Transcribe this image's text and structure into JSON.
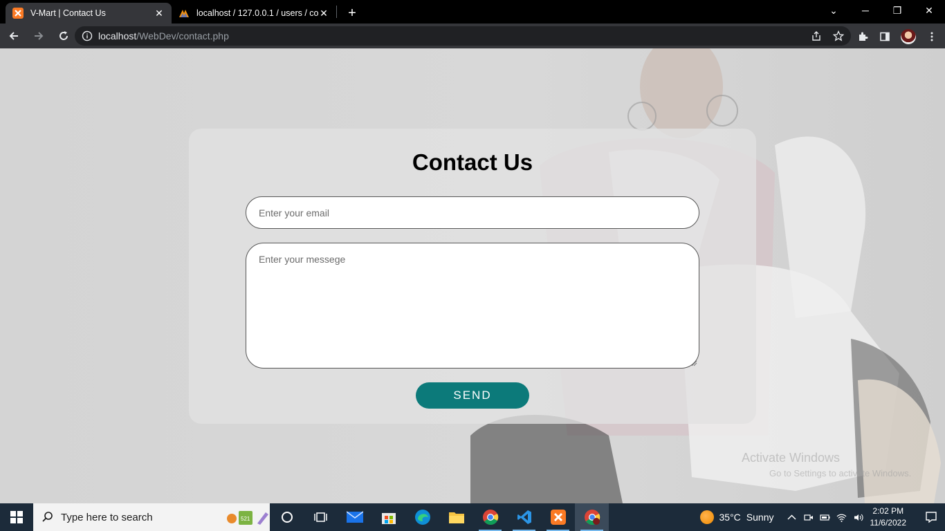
{
  "browser": {
    "tabs": [
      {
        "title": "V-Mart | Contact Us",
        "active": true
      },
      {
        "title": "localhost / 127.0.0.1 / users / con",
        "active": false
      }
    ],
    "url_host": "localhost",
    "url_path": "/WebDev/contact.php"
  },
  "page": {
    "title": "Contact Us",
    "email_placeholder": "Enter your email",
    "message_placeholder": "Enter your messege",
    "send_label": "SEND",
    "watermark_title": "Activate Windows",
    "watermark_sub": "Go to Settings to activate Windows."
  },
  "taskbar": {
    "search_placeholder": "Type here to search",
    "apps": [
      "cortana-icon",
      "task-view-icon",
      "mail-icon",
      "store-icon",
      "edge-icon",
      "file-explorer-icon",
      "chrome-icon",
      "vscode-icon",
      "xampp-icon",
      "chrome-profile-icon"
    ],
    "weather_temp": "35°C",
    "weather_text": "Sunny",
    "time": "2:02 PM",
    "date": "11/6/2022"
  },
  "colors": {
    "accent": "#0c7a7a",
    "chrome_dark": "#35363a",
    "taskbar": "#1c2b3a"
  }
}
